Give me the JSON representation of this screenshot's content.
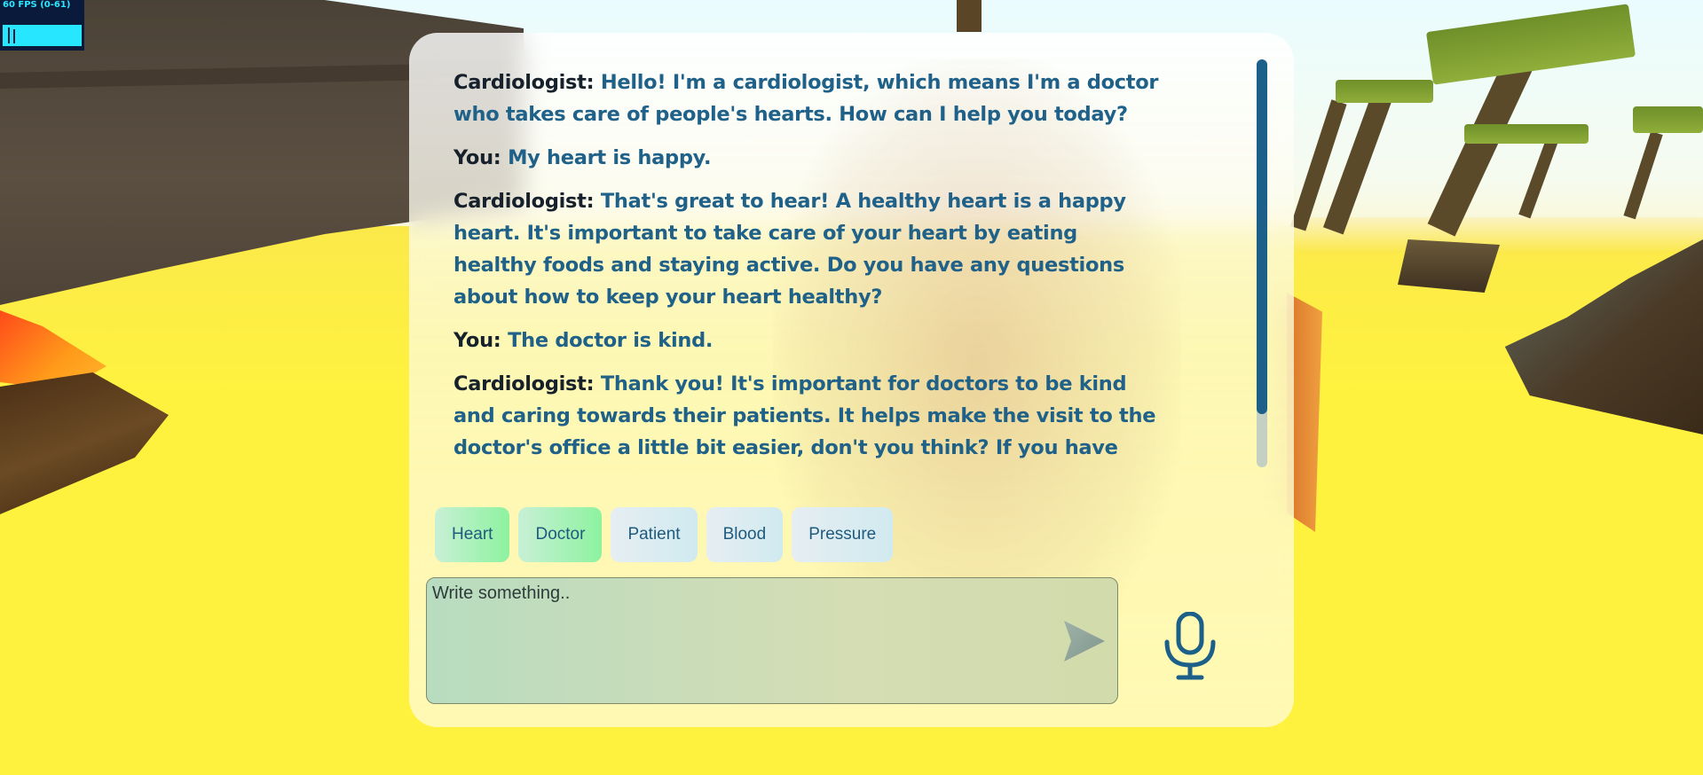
{
  "fps": {
    "label": "60 FPS (0-61)"
  },
  "chat": {
    "messages": [
      {
        "speaker": "Cardiologist:",
        "text": "Hello! I'm a cardiologist, which means I'm a doctor who takes care of people's hearts. How can I help you today?"
      },
      {
        "speaker": "You:",
        "text": "My heart is happy."
      },
      {
        "speaker": "Cardiologist:",
        "text": "That's great to hear! A healthy heart is a happy heart. It's important to take care of your heart by eating healthy foods and staying active. Do you have any questions about how to keep your heart healthy?"
      },
      {
        "speaker": "You:",
        "text": "The doctor is kind."
      },
      {
        "speaker": "Cardiologist:",
        "text": "Thank you! It's important for doctors to be kind and caring towards their patients. It helps make the visit to the doctor's office a little bit easier, don't you think? If you have any questions"
      }
    ]
  },
  "chips": [
    "Heart",
    "Doctor",
    "Patient",
    "Blood",
    "Pressure"
  ],
  "input": {
    "placeholder": "Write something.."
  },
  "icons": {
    "send": "send-arrow-icon",
    "mic": "microphone-icon"
  },
  "colors": {
    "accent": "#1c5f88",
    "speaker": "#17212b",
    "message": "#1f6188"
  }
}
